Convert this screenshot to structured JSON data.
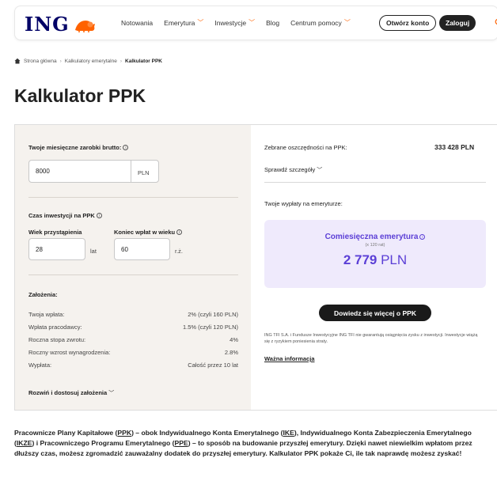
{
  "header": {
    "logo_text": "ING",
    "nav": [
      {
        "label": "Notowania",
        "dropdown": false
      },
      {
        "label": "Emerytura",
        "dropdown": true
      },
      {
        "label": "Inwestycje",
        "dropdown": true
      },
      {
        "label": "Blog",
        "dropdown": false
      },
      {
        "label": "Centrum pomocy",
        "dropdown": true
      }
    ],
    "open_account": "Otwórz konto",
    "login": "Zaloguj"
  },
  "breadcrumb": [
    "Strona główna",
    "Kalkulatory emerytalne",
    "Kalkulator PPK"
  ],
  "title": "Kalkulator PPK",
  "calc": {
    "salary_label": "Twoje miesięczne zarobki brutto:",
    "salary_value": "8000",
    "salary_unit": "PLN",
    "period_label": "Czas inwestycji na PPK",
    "join_age_label": "Wiek przystąpienia",
    "join_age_value": "28",
    "join_age_unit": "lat",
    "end_age_label": "Koniec wpłat w wieku",
    "end_age_value": "60",
    "end_age_unit": "r.ż.",
    "assumptions_label": "Założenia:",
    "assumptions": [
      {
        "label": "Twoja wpłata:",
        "value": "2% (czyli 160 PLN)"
      },
      {
        "label": "Wpłata pracodawcy:",
        "value": "1.5% (czyli 120 PLN)"
      },
      {
        "label": "Roczna stopa zwrotu:",
        "value": "4%"
      },
      {
        "label": "Roczny wzrost wynagrodzenia:",
        "value": "2.8%"
      },
      {
        "label": "Wypłata:",
        "value": "Całość przez 10 lat"
      }
    ],
    "expand_label": "Rozwiń i dostosuj założenia"
  },
  "result": {
    "savings_label": "Zebrane oszczędności na PPK:",
    "savings_value": "333 428 PLN",
    "details_label": "Sprawdź szczegóły",
    "payouts_label": "Twoje wypłaty na emeryturze:",
    "monthly_title": "Comiesięczna emerytura",
    "monthly_sub": "(x 120 rat)",
    "monthly_amount": "2 779",
    "monthly_currency": "PLN",
    "cta": "Dowiedz się więcej o PPK",
    "disclaimer": "ING TFI S.A. i Fundusze Inwestycyjne ING TFI nie gwarantują osiągnięcia zysku z inwestycji. Inwestycje wiążą się z ryzykiem poniesienia straty.",
    "important_link": "Ważna informacja"
  },
  "paragraph": {
    "p1": "Pracownicze Plany Kapitałowe (",
    "ppk": "PPK",
    "p2": ") – obok Indywidualnego Konta Emerytalnego (",
    "ike": "IKE",
    "p3": "), Indywidualnego Konta Zabezpieczenia Emerytalnego (",
    "ikze": "IKZE",
    "p4": ") i Pracowniczego Programu Emerytalnego (",
    "ppe": "PPE",
    "p5": ") – to sposób na budowanie przyszłej emerytury. Dzięki nawet niewielkim wpłatom przez dłuższy czas, możesz zgromadzić zauważalny dodatek do przyszłej emerytury. Kalkulator PPK pokaże Ci, ile tak naprawdę możesz zyskać!"
  },
  "colors": {
    "accent": "#ff6200",
    "brand": "#000066",
    "purple": "#5b3fd6",
    "card_bg": "#efeafc",
    "panel_bg": "#f5f2ee"
  }
}
